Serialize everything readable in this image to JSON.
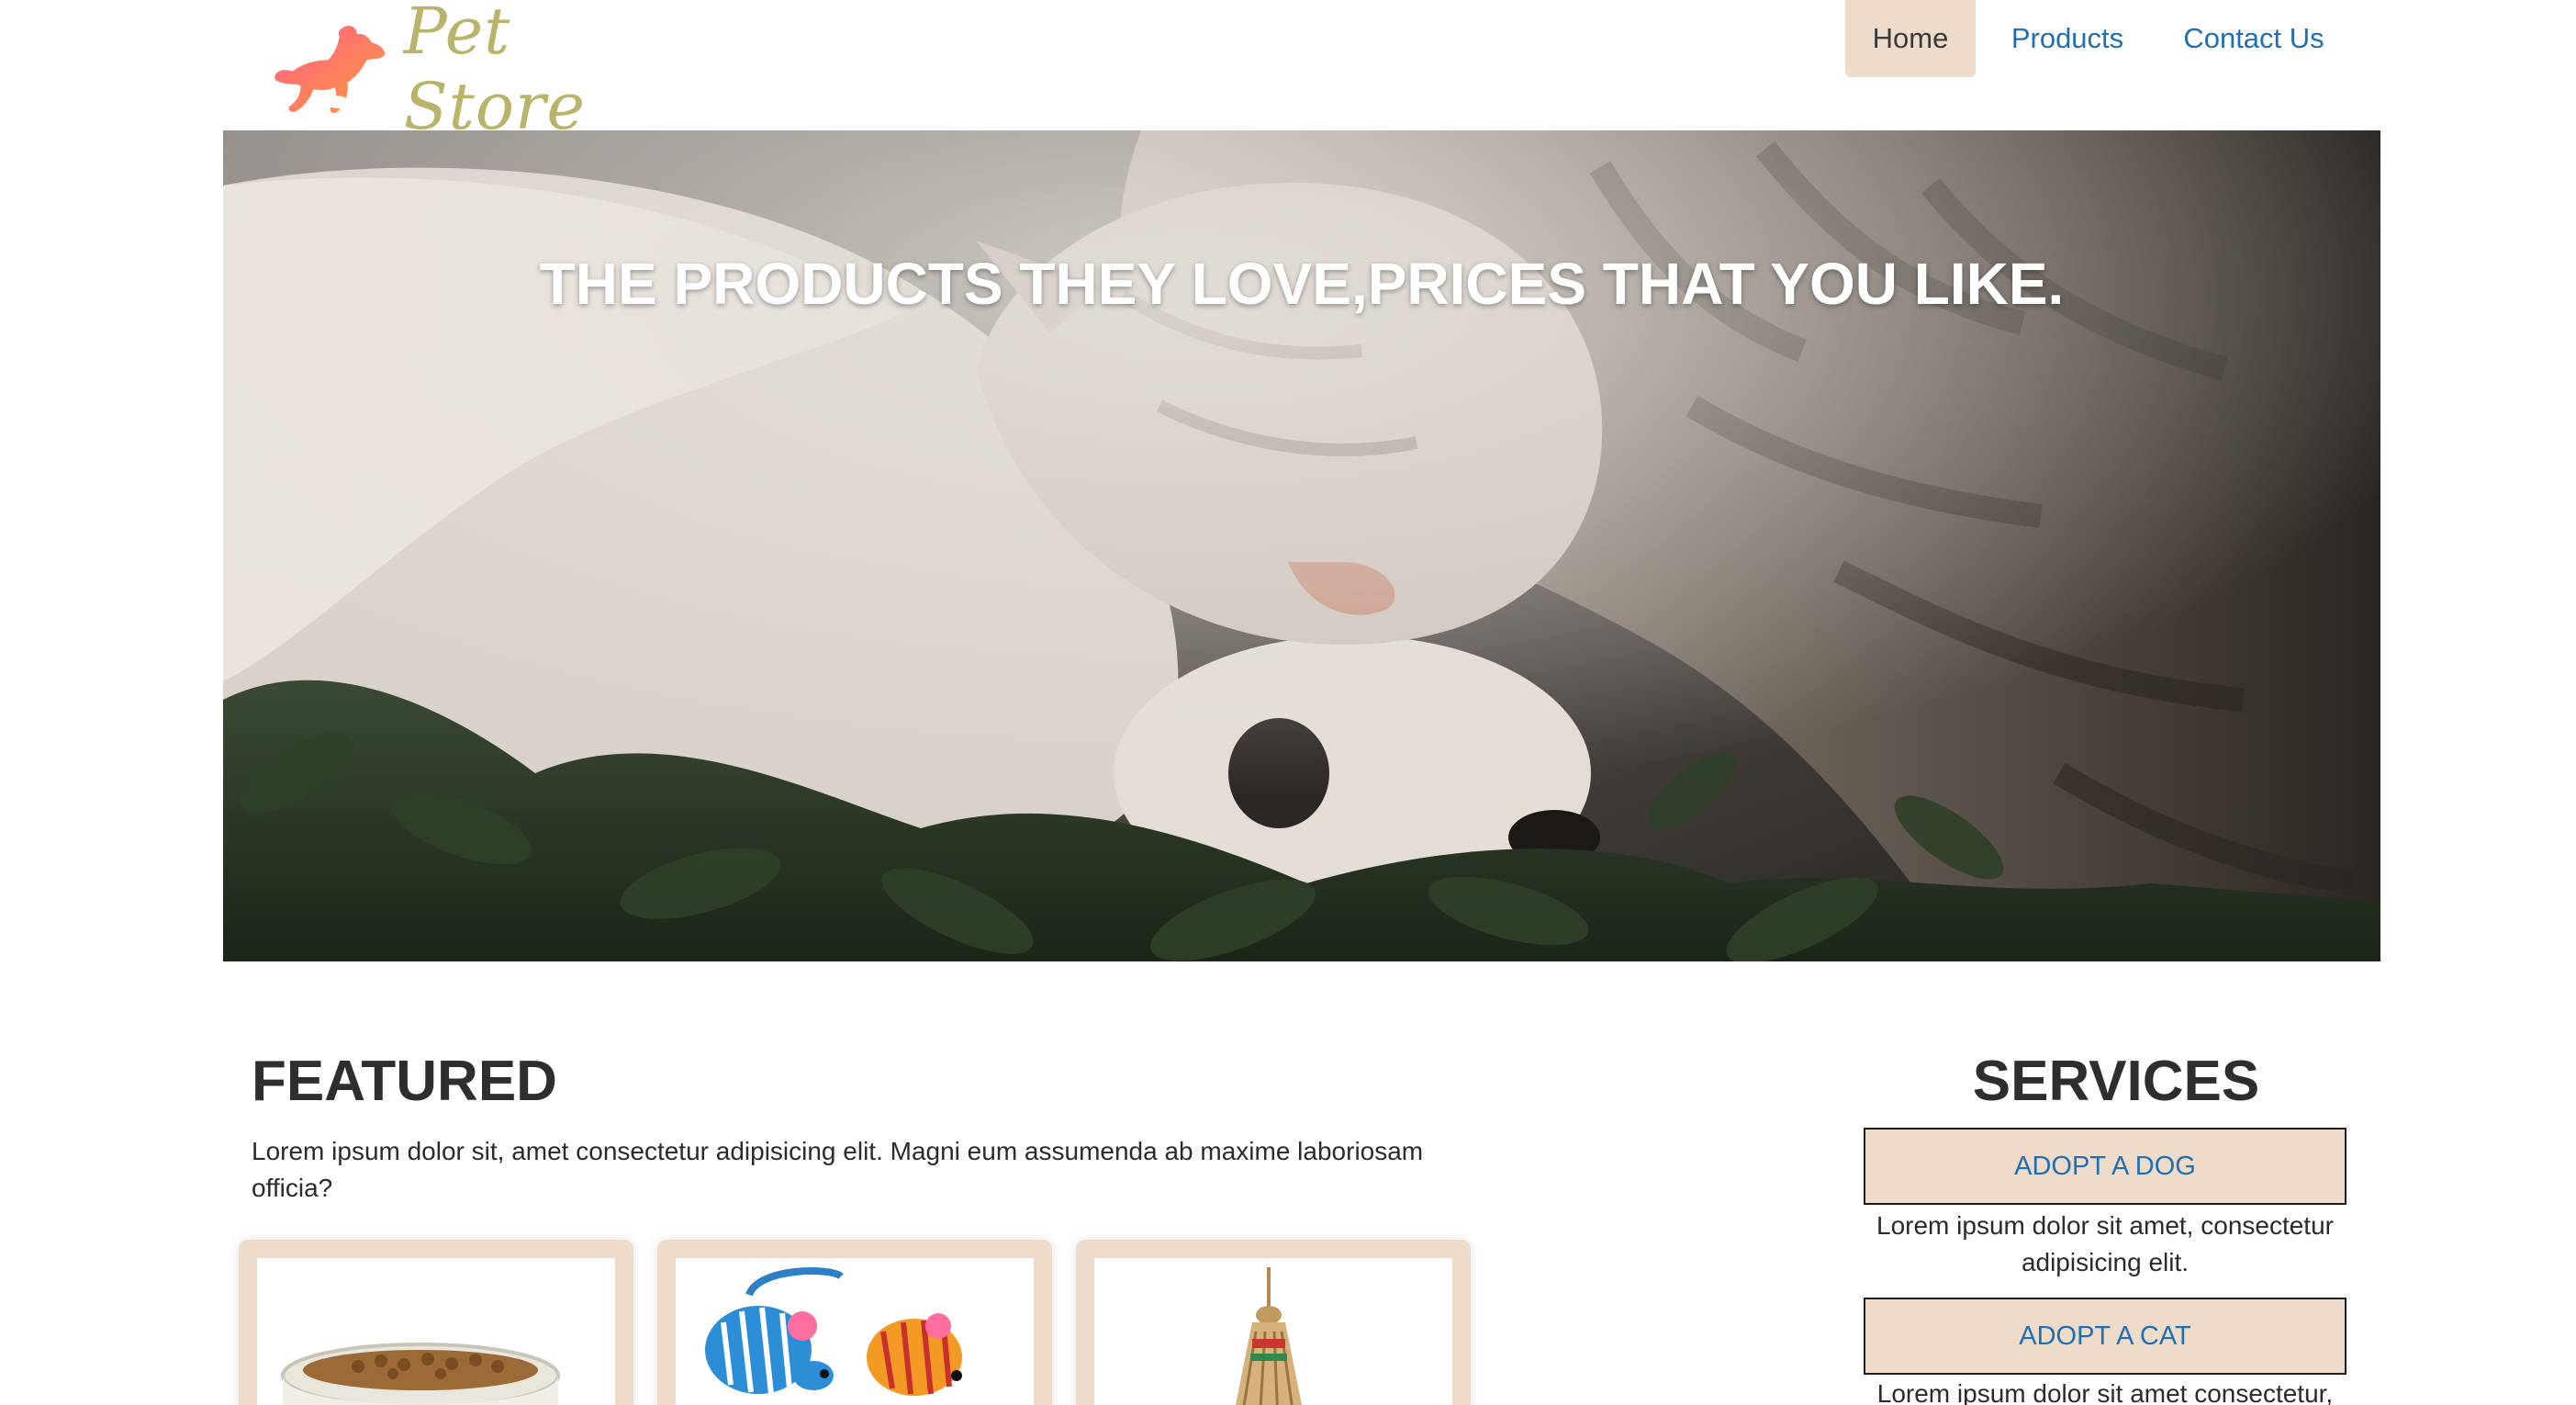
{
  "brand": {
    "name": "Pet Store",
    "text_color": "#b9b469",
    "logo_gradient": [
      "#ff5e8a",
      "#ff9a3c"
    ]
  },
  "nav": {
    "items": [
      {
        "label": "Home",
        "active": true
      },
      {
        "label": "Products",
        "active": false
      },
      {
        "label": "Contact Us",
        "active": false
      }
    ],
    "active_bg": "#eedbca",
    "link_color": "#1f6fb2"
  },
  "hero": {
    "tagline": "THE PRODUCTS THEY LOVE,PRICES THAT YOU LIKE."
  },
  "featured": {
    "title": "FEATURED",
    "description": "Lorem ipsum dolor sit, amet consectetur adipisicing elit. Magni eum assumenda ab maxime laboriosam officia?",
    "products": [
      {
        "icon": "food-bowl-icon"
      },
      {
        "icon": "toy-mice-icon"
      },
      {
        "icon": "rope-toy-icon"
      }
    ]
  },
  "services": {
    "title": "SERVICES",
    "items": [
      {
        "label": "ADOPT A DOG",
        "description": "Lorem ipsum dolor sit amet, consectetur adipisicing elit."
      },
      {
        "label": "ADOPT A CAT",
        "description": "Lorem ipsum dolor sit amet consectetur,"
      }
    ]
  }
}
